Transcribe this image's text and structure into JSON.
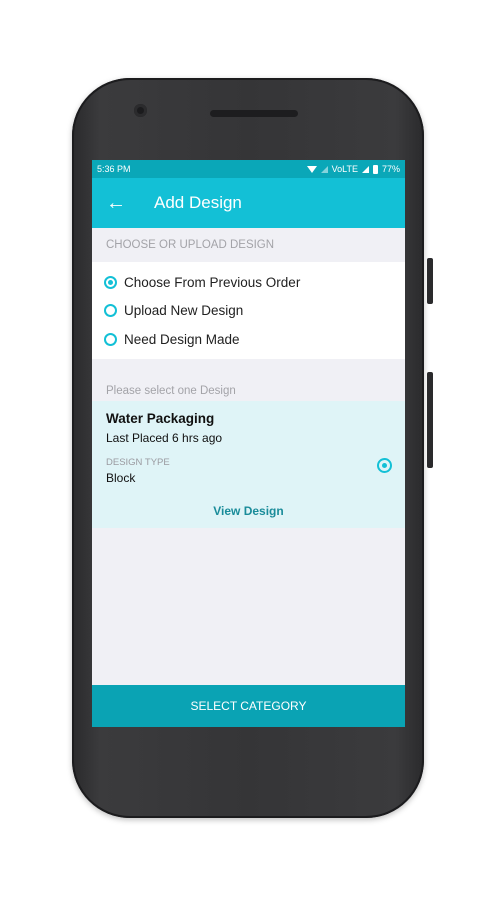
{
  "status_bar": {
    "time": "5:36 PM",
    "network": "VoLTE",
    "battery": "77%"
  },
  "app_bar": {
    "back_icon": "arrow-left-icon",
    "title": "Add Design"
  },
  "upload_section": {
    "header": "CHOOSE OR UPLOAD DESIGN",
    "options": [
      {
        "label": "Choose From Previous Order",
        "selected": true
      },
      {
        "label": "Upload New Design",
        "selected": false
      },
      {
        "label": "Need Design Made",
        "selected": false
      }
    ]
  },
  "design_list": {
    "header": "Please select one Design",
    "items": [
      {
        "name": "Water Packaging",
        "last_placed": "Last Placed 6 hrs ago",
        "type_label": "DESIGN TYPE",
        "type_value": "Block",
        "view_label": "View Design",
        "selected": true
      }
    ]
  },
  "footer": {
    "button_label": "SELECT CATEGORY"
  },
  "colors": {
    "accent": "#13c0d6",
    "status_bar": "#0aa7b8",
    "bottom_button": "#0aa3b4",
    "card_background": "#dff4f7",
    "link": "#1a8c9a"
  }
}
